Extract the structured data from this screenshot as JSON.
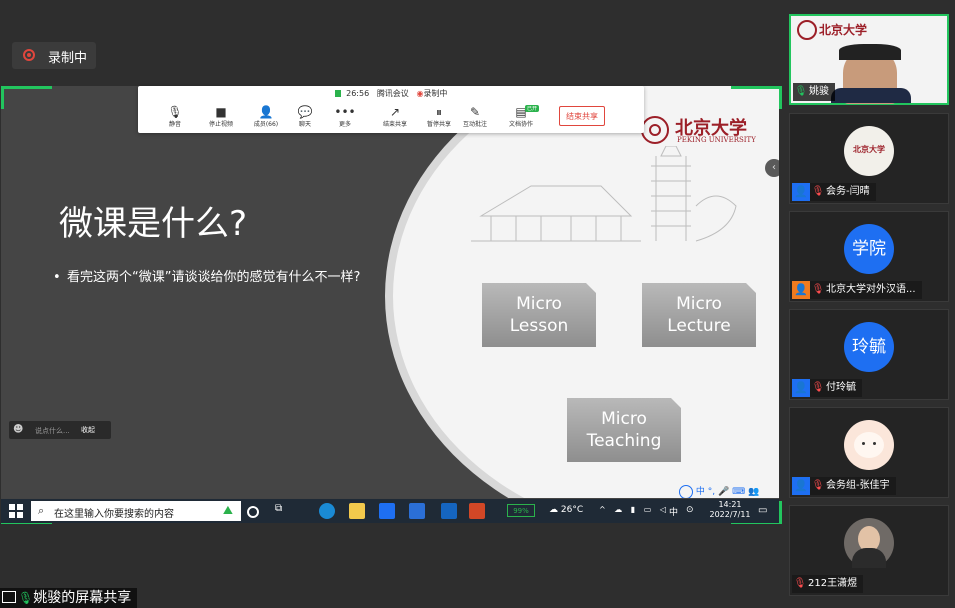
{
  "recording": {
    "label": "录制中"
  },
  "toolbar": {
    "time": "26:56",
    "meeting_label": "腾讯会议",
    "recording_label": "录制中",
    "buttons": [
      "静音",
      "停止视频",
      "成员(66)",
      "聊天",
      "更多",
      "结束共享",
      "暂停共享",
      "互动批注",
      "文档协作"
    ],
    "collab_badge": "已开",
    "end_button": "结束共享"
  },
  "slide": {
    "title": "微课是什么?",
    "bullet": "看完这两个“微课”请谈谈给你的感觉有什么不一样?",
    "logo_cn": "北京大学",
    "logo_en": "PEKING UNIVERSITY",
    "cards": [
      {
        "line1": "Micro",
        "line2": "Lesson"
      },
      {
        "line1": "Micro",
        "line2": "Lecture"
      },
      {
        "line1": "Micro",
        "line2": "Teaching"
      }
    ]
  },
  "chat_mini": {
    "placeholder": "说点什么...",
    "collapse": "收起"
  },
  "taskbar": {
    "search_placeholder": "在这里输入你要搜索的内容",
    "battery": "99%",
    "temperature": "26°C",
    "ime": "中",
    "time": "14:21",
    "date": "2022/7/11",
    "ime_bar": [
      "中",
      "°,",
      "🎤",
      "⌨",
      "👥"
    ]
  },
  "participants": [
    {
      "name": "姚骏",
      "type": "video",
      "active": true
    },
    {
      "name": "会务-闫晴",
      "type": "logo"
    },
    {
      "name": "北京大学对外汉语...",
      "type": "text-avatar",
      "avatar_text": "学院"
    },
    {
      "name": "付玲毓",
      "type": "text-avatar",
      "avatar_text": "玲毓"
    },
    {
      "name": "会务组-张佳宇",
      "type": "cat-avatar"
    },
    {
      "name": "212王潇煜",
      "type": "photo"
    }
  ],
  "share_label": "姚骏的屏幕共享",
  "colors": {
    "accent_green": "#22c55e",
    "record_red": "#e0463d",
    "pku_red": "#9c1f28",
    "tile_bg": "#242424"
  }
}
